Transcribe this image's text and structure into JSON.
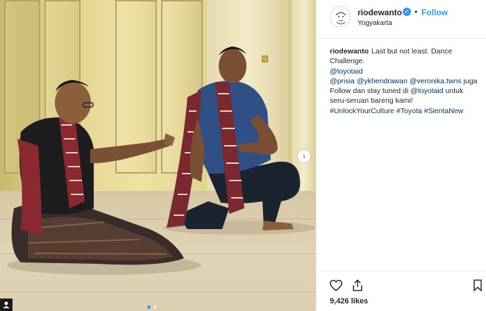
{
  "post": {
    "username": "riodewanto",
    "location": "Yogyakarta",
    "follow_label": "Follow",
    "separator": "•",
    "verified_icon": "verified-badge-icon",
    "caption": {
      "username": "riodewanto",
      "line1": "Last but not least. Dance Challenge.",
      "mention1": "@toyotaid",
      "mention2": "@prisia",
      "mention3": "@ykhendrawan",
      "mention4": "@veronika.twns",
      "text2": "juga Follow dan stay tuned di",
      "mention5": "@toyotaid",
      "text3": "untuk seru-seruan bareng kami!",
      "hashtag1": "#UnlockYourCulture",
      "hashtag2": "#Toyota",
      "hashtag3": "#SientaNew"
    },
    "likes": "9,426 likes",
    "accent_color": "#3897f0",
    "link_color": "#003569"
  },
  "media": {
    "corner_badge": "👤",
    "next_arrow": "›",
    "carousel_pages": 2,
    "carousel_active": 1
  }
}
